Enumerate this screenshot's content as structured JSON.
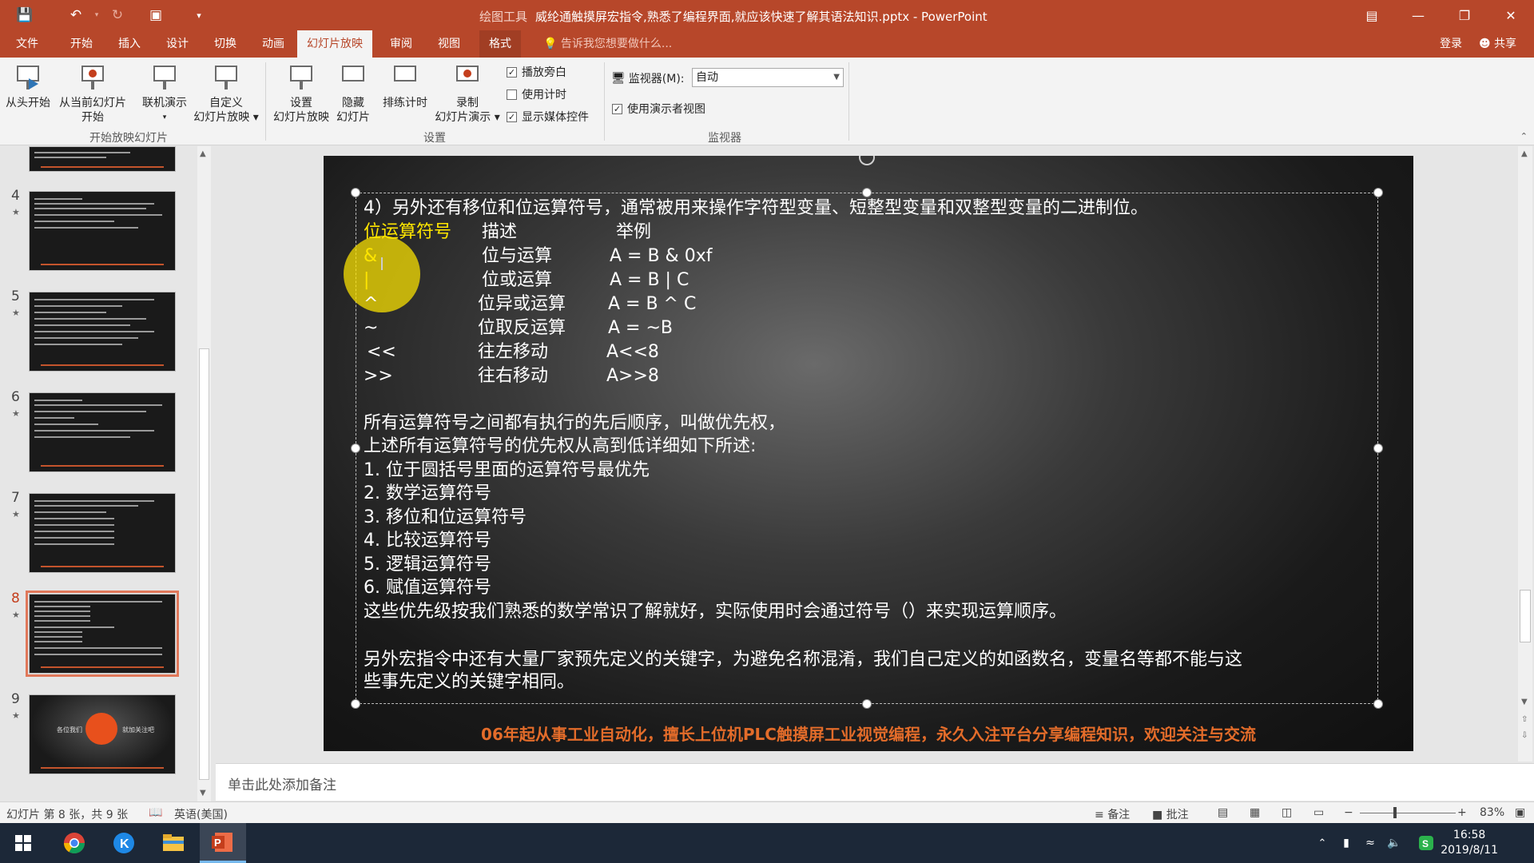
{
  "titlebar": {
    "context": "绘图工具",
    "title": "威纶通触摸屏宏指令,熟悉了编程界面,就应该快速了解其语法知识.pptx - PowerPoint"
  },
  "tabs": [
    "文件",
    "开始",
    "插入",
    "设计",
    "切换",
    "动画",
    "幻灯片放映",
    "审阅",
    "视图",
    "格式"
  ],
  "tell_me": "告诉我您想要做什么...",
  "login": "登录",
  "share": "共享",
  "ribbon": {
    "from_beginning": "从头开始",
    "from_current_1": "从当前幻灯片",
    "from_current_2": "开始",
    "online": "联机演示",
    "custom_1": "自定义",
    "custom_2": "幻灯片放映",
    "group_start": "开始放映幻灯片",
    "setup_1": "设置",
    "setup_2": "幻灯片放映",
    "hide_1": "隐藏",
    "hide_2": "幻灯片",
    "rehearse": "排练计时",
    "record_1": "录制",
    "record_2": "幻灯片演示",
    "play_narration": "播放旁白",
    "use_timings": "使用计时",
    "show_media": "显示媒体控件",
    "group_setup": "设置",
    "monitor_label": "监视器(M):",
    "monitor_value": "自动",
    "presenter_view": "使用演示者视图",
    "group_monitor": "监视器"
  },
  "thumbnails": [
    {
      "num": "4",
      "star": "★"
    },
    {
      "num": "5",
      "star": "★"
    },
    {
      "num": "6",
      "star": "★"
    },
    {
      "num": "7",
      "star": "★"
    },
    {
      "num": "8",
      "star": "★"
    },
    {
      "num": "9",
      "star": "★"
    }
  ],
  "slide": {
    "intro": "4）另外还有移位和位运算符号，通常被用来操作字符型变量、短整型变量和双整型变量的二进制位。",
    "table_header": [
      "位运算符号",
      "描述",
      "举例"
    ],
    "table_rows": [
      [
        "&",
        "位与运算",
        "A = B & 0xf"
      ],
      [
        "|",
        "位或运算",
        "A = B | C"
      ],
      [
        "^",
        "位异或运算",
        "A = B ^ C"
      ],
      [
        "~",
        "位取反运算",
        "A = ~B"
      ],
      [
        "<<",
        "往左移动",
        "A<<8"
      ],
      [
        ">>",
        "往右移动",
        "A>>8"
      ]
    ],
    "priority_1": "所有运算符号之间都有执行的先后顺序，叫做优先权，",
    "priority_2": "上述所有运算符号的优先权从高到低详细如下所述:",
    "list": [
      "1. 位于圆括号里面的运算符号最优先",
      "2. 数学运算符号",
      "3. 移位和位运算符号",
      "4. 比较运算符号",
      "5. 逻辑运算符号",
      "6. 赋值运算符号"
    ],
    "note": "这些优先级按我们熟悉的数学常识了解就好，实际使用时会通过符号（）来实现运算顺序。",
    "keyword_1": "另外宏指令中还有大量厂家预先定义的关键字，为避免名称混淆，我们自己定义的如函数名，变量名等都不能与这",
    "keyword_2": "些事先定义的关键字相同。",
    "footer": "06年起从事工业自动化，擅长上位机PLC触摸屏工业视觉编程，永久入注平台分享编程知识，欢迎关注与交流"
  },
  "thumb9_left": "各位我们",
  "thumb9_right": "就加关注吧",
  "notes_placeholder": "单击此处添加备注",
  "status": {
    "slide_info": "幻灯片 第 8 张，共 9 张",
    "language": "英语(美国)",
    "notes": "备注",
    "comments": "批注",
    "zoom": "83%"
  },
  "clock": {
    "time": "16:58",
    "date": "2019/8/11"
  },
  "colors": {
    "accent": "#b7472a",
    "footer_text": "#e36c2a",
    "highlight": "#ffe600"
  }
}
